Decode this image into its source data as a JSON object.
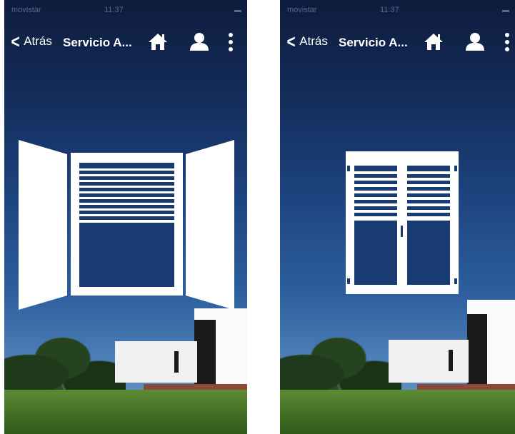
{
  "screens": [
    {
      "id": "left",
      "status_bar": {
        "carrier": "movistar",
        "time": "11:37"
      },
      "nav": {
        "back_label": "Atrás",
        "title": "Servicio A..."
      },
      "shutter": {
        "state": "open",
        "icon": "open-window-with-blind-icon"
      }
    },
    {
      "id": "right",
      "status_bar": {
        "carrier": "movistar",
        "time": "11:37"
      },
      "nav": {
        "back_label": "Atrás",
        "title": "Servicio A..."
      },
      "shutter": {
        "state": "closed",
        "icon": "closed-shutter-window-icon"
      }
    }
  ],
  "icons": {
    "home": "home-icon",
    "user": "user-icon",
    "more": "more-vertical-icon",
    "back": "chevron-left-icon"
  },
  "colors": {
    "nav_text": "#ffffff",
    "icon_fill": "#ffffff"
  }
}
